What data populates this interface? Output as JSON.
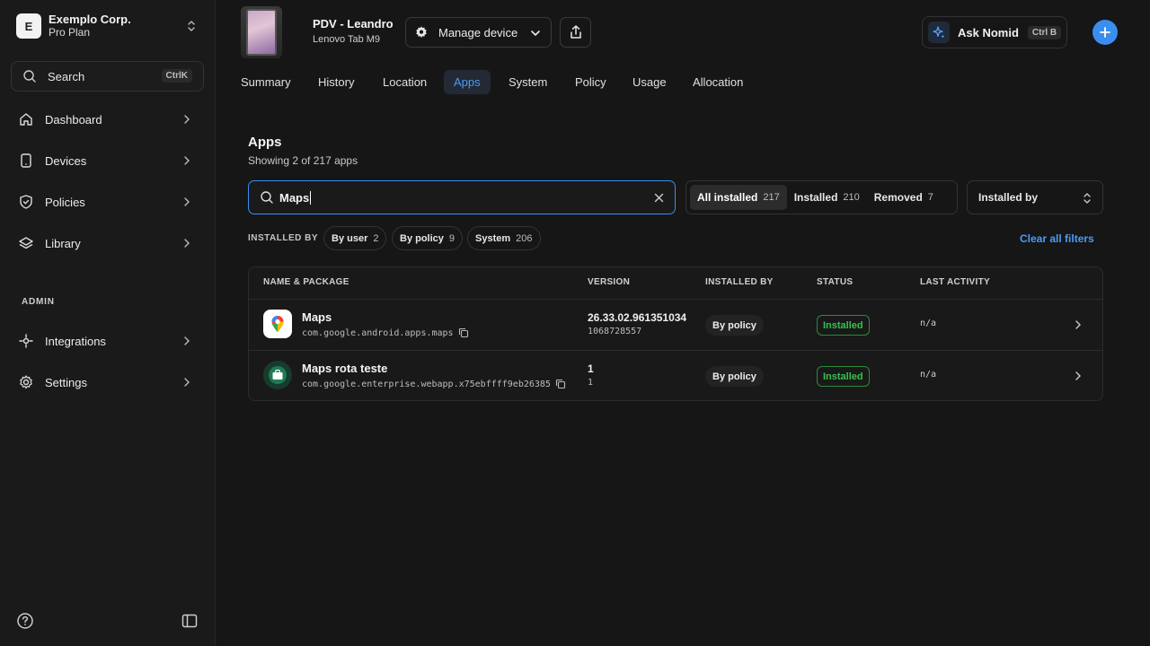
{
  "org": {
    "initial": "E",
    "name": "Exemplo Corp.",
    "plan": "Pro Plan"
  },
  "sidebar": {
    "search_label": "Search",
    "search_shortcut": "CtrlK",
    "items": [
      {
        "label": "Dashboard",
        "icon": "home-icon"
      },
      {
        "label": "Devices",
        "icon": "device-icon"
      },
      {
        "label": "Policies",
        "icon": "shield-icon"
      },
      {
        "label": "Library",
        "icon": "layers-icon"
      }
    ],
    "admin_label": "ADMIN",
    "admin_items": [
      {
        "label": "Integrations",
        "icon": "integrations-icon"
      },
      {
        "label": "Settings",
        "icon": "gear-icon"
      }
    ]
  },
  "device": {
    "title": "PDV - Leandro",
    "model": "Lenovo Tab M9"
  },
  "header": {
    "manage_label": "Manage device",
    "ask_label": "Ask Nomid",
    "ask_shortcut": "Ctrl B"
  },
  "tabs": [
    "Summary",
    "History",
    "Location",
    "Apps",
    "System",
    "Policy",
    "Usage",
    "Allocation"
  ],
  "active_tab": "Apps",
  "apps": {
    "title": "Apps",
    "subtitle": "Showing 2 of 217 apps",
    "search_value": "Maps",
    "segments": [
      {
        "label": "All installed",
        "count": "217",
        "active": true
      },
      {
        "label": "Installed",
        "count": "210",
        "active": false
      },
      {
        "label": "Removed",
        "count": "7",
        "active": false
      }
    ],
    "installed_by_select": "Installed by",
    "filter_label": "INSTALLED BY",
    "chips": [
      {
        "label": "By user",
        "count": "2"
      },
      {
        "label": "By policy",
        "count": "9"
      },
      {
        "label": "System",
        "count": "206"
      }
    ],
    "clear_all": "Clear all filters",
    "columns": [
      "NAME & PACKAGE",
      "VERSION",
      "INSTALLED BY",
      "STATUS",
      "LAST ACTIVITY"
    ],
    "rows": [
      {
        "name": "Maps",
        "package": "com.google.android.apps.maps",
        "version": "26.33.02.961351034",
        "version_code": "1068728557",
        "installed_by": "By policy",
        "status": "Installed",
        "last_activity": "n/a"
      },
      {
        "name": "Maps rota teste",
        "package": "com.google.enterprise.webapp.x75ebffff9eb26385",
        "version": "1",
        "version_code": "1",
        "installed_by": "By policy",
        "status": "Installed",
        "last_activity": "n/a"
      }
    ]
  },
  "colors": {
    "accent": "#3a8ef0",
    "active_tab_text": "#4a9bf5",
    "status_green": "#38c14f",
    "background": "#161616"
  }
}
